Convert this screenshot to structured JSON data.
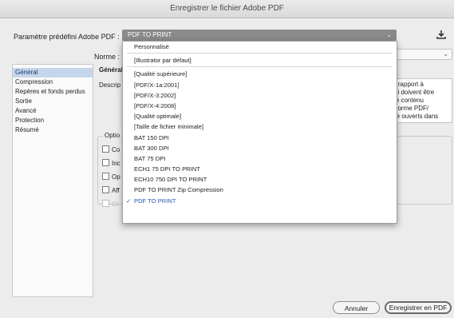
{
  "window": {
    "title": "Enregistrer le fichier Adobe PDF"
  },
  "preset": {
    "label": "Paramètre prédéfini Adobe PDF :",
    "value": "PDF TO PRINT",
    "save_icon": "download-icon"
  },
  "norme": {
    "label": "Norme :"
  },
  "sidebar": {
    "items": [
      {
        "label": "Général",
        "active": true
      },
      {
        "label": "Compression"
      },
      {
        "label": "Repères et fonds perdus"
      },
      {
        "label": "Sortie"
      },
      {
        "label": "Avancé"
      },
      {
        "label": "Protection"
      },
      {
        "label": "Résumé"
      }
    ]
  },
  "general": {
    "heading": "Général",
    "description_label": "Descrip",
    "description_lines": [
      "r rapport à",
      "ui doivent être",
      "le contenu",
      "norme PDF/",
      "re ouverts dans"
    ],
    "options_label": "Optio",
    "options": [
      {
        "label": "Co"
      },
      {
        "label": "Inc"
      },
      {
        "label": "Op"
      },
      {
        "label": "Aff"
      },
      {
        "label": "Cr",
        "disabled": true
      }
    ]
  },
  "dropdown": {
    "groups": [
      [
        {
          "label": "Personnalisé"
        }
      ],
      [
        {
          "label": "[Illustrator par défaut]"
        }
      ],
      [
        {
          "label": "[Qualité supérieure]"
        },
        {
          "label": "[PDF/X-1a:2001]"
        },
        {
          "label": "[PDF/X-3:2002]"
        },
        {
          "label": "[PDF/X-4:2008]"
        },
        {
          "label": "[Qualité optimale]"
        },
        {
          "label": "[Taille de fichier minimale]"
        },
        {
          "label": "BAT 150 DPI"
        },
        {
          "label": "BAT 300 DPI"
        },
        {
          "label": "BAT 75 DPI"
        },
        {
          "label": "ECH1 75 DPI TO PRINT"
        },
        {
          "label": "ECH10 750 DPI TO PRINT"
        },
        {
          "label": "PDF TO PRINT Zip Compression"
        },
        {
          "label": "PDF TO PRINT",
          "selected": true
        }
      ]
    ],
    "check_glyph": "✓"
  },
  "buttons": {
    "cancel": "Annuler",
    "save": "Enregistrer en PDF"
  }
}
